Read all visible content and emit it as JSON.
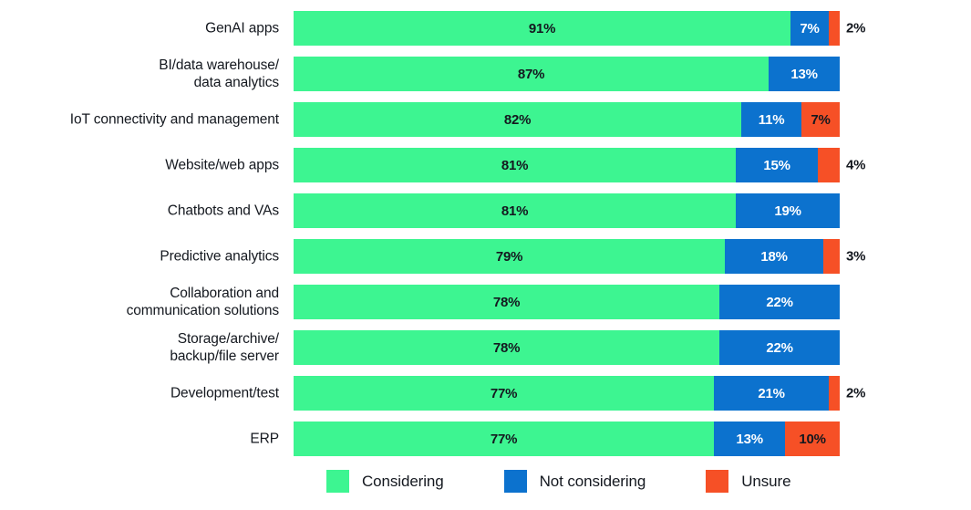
{
  "chart_data": {
    "type": "bar",
    "orientation": "horizontal",
    "stacked": true,
    "stacked_percent": true,
    "title": "",
    "subtitle": "",
    "xlabel": "",
    "ylabel": "",
    "xlim": [
      0,
      100
    ],
    "grid": false,
    "legend_position": "bottom",
    "value_suffix": "%",
    "categories": [
      "GenAI apps",
      "BI/data warehouse/\ndata analytics",
      "IoT connectivity and management",
      "Website/web apps",
      "Chatbots and VAs",
      "Predictive analytics",
      "Collaboration and\ncommunication solutions",
      "Storage/archive/\nbackup/file server",
      "Development/test",
      "ERP"
    ],
    "series": [
      {
        "name": "Considering",
        "color": "#3df591",
        "values": [
          91,
          87,
          82,
          81,
          81,
          79,
          78,
          78,
          77,
          77
        ]
      },
      {
        "name": "Not considering",
        "color": "#0c72ce",
        "values": [
          7,
          13,
          11,
          15,
          19,
          18,
          22,
          22,
          21,
          13
        ]
      },
      {
        "name": "Unsure",
        "color": "#f65026",
        "values": [
          2,
          0,
          7,
          4,
          0,
          3,
          0,
          0,
          2,
          10
        ]
      }
    ],
    "rows": [
      {
        "category": "GenAI apps",
        "segments": [
          {
            "series": "Considering",
            "value": 91,
            "label": "91%",
            "label_inside": true
          },
          {
            "series": "Not considering",
            "value": 7,
            "label": "7%",
            "label_inside": true
          },
          {
            "series": "Unsure",
            "value": 2,
            "label": "2%",
            "label_inside": false
          }
        ]
      },
      {
        "category": "BI/data warehouse/\ndata analytics",
        "segments": [
          {
            "series": "Considering",
            "value": 87,
            "label": "87%",
            "label_inside": true
          },
          {
            "series": "Not considering",
            "value": 13,
            "label": "13%",
            "label_inside": true
          }
        ]
      },
      {
        "category": "IoT connectivity and management",
        "segments": [
          {
            "series": "Considering",
            "value": 82,
            "label": "82%",
            "label_inside": true
          },
          {
            "series": "Not considering",
            "value": 11,
            "label": "11%",
            "label_inside": true
          },
          {
            "series": "Unsure",
            "value": 7,
            "label": "7%",
            "label_inside": true
          }
        ]
      },
      {
        "category": "Website/web apps",
        "segments": [
          {
            "series": "Considering",
            "value": 81,
            "label": "81%",
            "label_inside": true
          },
          {
            "series": "Not considering",
            "value": 15,
            "label": "15%",
            "label_inside": true
          },
          {
            "series": "Unsure",
            "value": 4,
            "label": "4%",
            "label_inside": false
          }
        ]
      },
      {
        "category": "Chatbots and VAs",
        "segments": [
          {
            "series": "Considering",
            "value": 81,
            "label": "81%",
            "label_inside": true
          },
          {
            "series": "Not considering",
            "value": 19,
            "label": "19%",
            "label_inside": true
          }
        ]
      },
      {
        "category": "Predictive analytics",
        "segments": [
          {
            "series": "Considering",
            "value": 79,
            "label": "79%",
            "label_inside": true
          },
          {
            "series": "Not considering",
            "value": 18,
            "label": "18%",
            "label_inside": true
          },
          {
            "series": "Unsure",
            "value": 3,
            "label": "3%",
            "label_inside": false
          }
        ]
      },
      {
        "category": "Collaboration and\ncommunication solutions",
        "segments": [
          {
            "series": "Considering",
            "value": 78,
            "label": "78%",
            "label_inside": true
          },
          {
            "series": "Not considering",
            "value": 22,
            "label": "22%",
            "label_inside": true
          }
        ]
      },
      {
        "category": "Storage/archive/\nbackup/file server",
        "segments": [
          {
            "series": "Considering",
            "value": 78,
            "label": "78%",
            "label_inside": true
          },
          {
            "series": "Not considering",
            "value": 22,
            "label": "22%",
            "label_inside": true
          }
        ]
      },
      {
        "category": "Development/test",
        "segments": [
          {
            "series": "Considering",
            "value": 77,
            "label": "77%",
            "label_inside": true
          },
          {
            "series": "Not considering",
            "value": 21,
            "label": "21%",
            "label_inside": true
          },
          {
            "series": "Unsure",
            "value": 2,
            "label": "2%",
            "label_inside": false
          }
        ]
      },
      {
        "category": "ERP",
        "segments": [
          {
            "series": "Considering",
            "value": 77,
            "label": "77%",
            "label_inside": true
          },
          {
            "series": "Not considering",
            "value": 13,
            "label": "13%",
            "label_inside": true
          },
          {
            "series": "Unsure",
            "value": 10,
            "label": "10%",
            "label_inside": true
          }
        ]
      }
    ]
  },
  "legend": {
    "items": [
      {
        "label": "Considering",
        "color": "#3df591"
      },
      {
        "label": "Not considering",
        "color": "#0c72ce"
      },
      {
        "label": "Unsure",
        "color": "#f65026"
      }
    ]
  },
  "colors": {
    "considering": "#3df591",
    "not_considering": "#0c72ce",
    "unsure": "#f65026",
    "text_dark": "#14181f",
    "text_light": "#ffffff",
    "background": "#ffffff"
  }
}
